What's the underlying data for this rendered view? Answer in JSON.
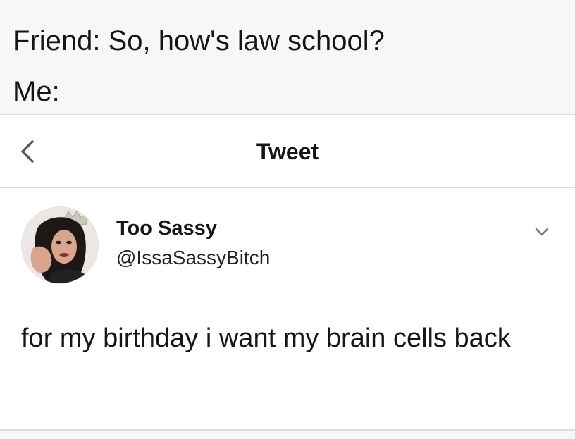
{
  "meme": {
    "line1": "Friend: So, how's law school?",
    "line2": "Me:"
  },
  "nav": {
    "back_icon": "chevron-left-icon",
    "title": "Tweet"
  },
  "tweet": {
    "avatar_icon": "profile-photo",
    "display_name": "Too Sassy",
    "handle": "@IssaSassyBitch",
    "more_icon": "chevron-down-icon",
    "text": "for my birthday i want my brain cells back"
  },
  "colors": {
    "caption_bg": "#f7f7f7",
    "divider": "#dcdcdc",
    "text": "#14171a"
  }
}
